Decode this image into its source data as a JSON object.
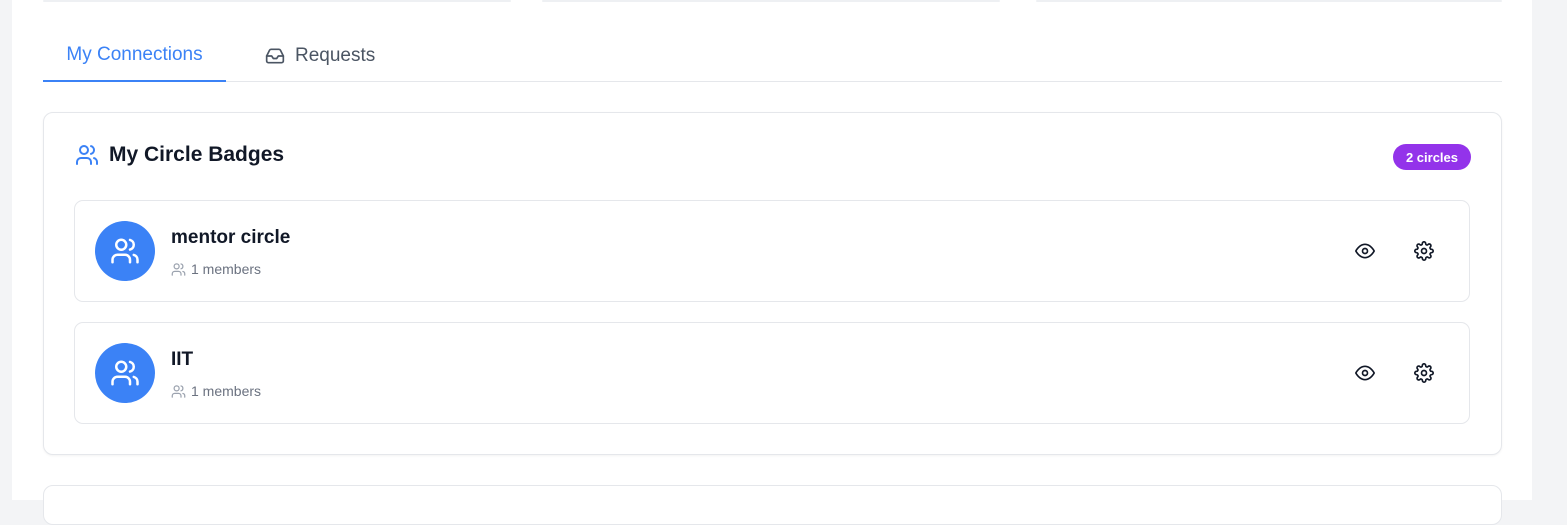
{
  "tabs": {
    "connections_label": "My Connections",
    "requests_label": "Requests"
  },
  "circles_card": {
    "title": "My Circle Badges",
    "count_badge": "2 circles",
    "items": [
      {
        "name": "mentor circle",
        "members": "1 members"
      },
      {
        "name": "IIT",
        "members": "1 members"
      }
    ]
  },
  "colors": {
    "accent": "#3b82f6",
    "badge": "#9333ea"
  },
  "icons": {
    "tab_requests": "inbox-icon",
    "card_header": "users-icon",
    "avatar": "users-icon",
    "members": "users-icon",
    "view": "eye-icon",
    "settings": "gear-icon"
  }
}
